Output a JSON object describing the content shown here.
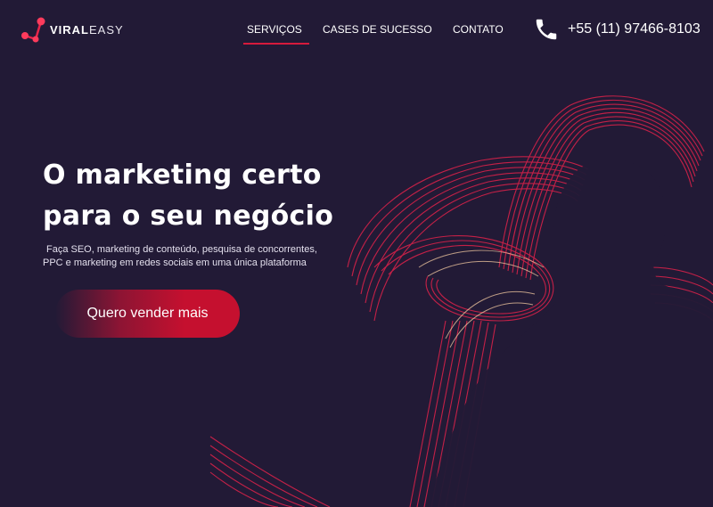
{
  "brand": {
    "name_bold": "VIRAL",
    "name_light": "EASY"
  },
  "nav": {
    "items": [
      {
        "label": "SERVIÇOS",
        "active": true
      },
      {
        "label": "CASES DE SUCESSO",
        "active": false
      },
      {
        "label": "CONTATO",
        "active": false
      }
    ]
  },
  "contact": {
    "phone": "+55 (11) 97466-8103",
    "icon": "phone-icon"
  },
  "hero": {
    "title_line1": "O marketing certo",
    "title_line2": "para o seu negócio",
    "subtitle_line1": "Faça SEO, marketing de conteúdo, pesquisa de concorrentes,",
    "subtitle_line2": "PPC  e  marketing em redes sociais em uma única plataforma",
    "cta_label": "Quero vender mais"
  },
  "colors": {
    "background": "#221a36",
    "accent": "#d61a3c",
    "light_trails": "#e8254a",
    "highlight": "#f2c9a0"
  }
}
